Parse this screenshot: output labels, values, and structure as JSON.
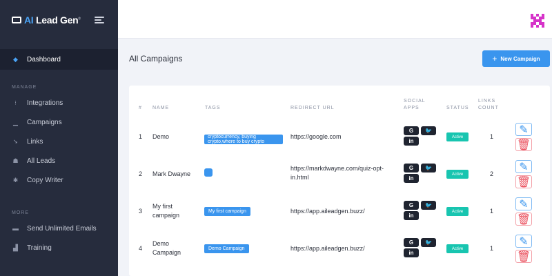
{
  "brand": {
    "ai": "AI",
    "rest": " Lead Gen",
    "tm": "®"
  },
  "sidebar": {
    "dashboard": "Dashboard",
    "manage_label": "MANAGE",
    "items": [
      {
        "label": "Integrations",
        "icon": "integrations-icon"
      },
      {
        "label": "Campaigns",
        "icon": "campaigns-icon"
      },
      {
        "label": "Links",
        "icon": "links-icon"
      },
      {
        "label": "All Leads",
        "icon": "users-icon"
      },
      {
        "label": "Copy Writer",
        "icon": "copywriter-icon"
      }
    ],
    "more_label": "MORE",
    "more_items": [
      {
        "label": "Send Unlimited Emails",
        "icon": "email-icon"
      },
      {
        "label": "Training",
        "icon": "training-icon"
      }
    ]
  },
  "main": {
    "title": "All Campaigns",
    "new_button": "New Campaign"
  },
  "table": {
    "headers": {
      "num": "#",
      "name": "NAME",
      "tags": "TAGS",
      "redirect": "REDIRECT URL",
      "social_1": "SOCIAL",
      "social_2": "APPS",
      "status": "STATUS",
      "links_1": "LINKS",
      "links_2": "COUNT"
    },
    "rows": [
      {
        "num": "1",
        "name": "Demo",
        "tag": "cryptocurrency, buying crypto,where to buy crypto",
        "url": "https://google.com",
        "status": "Active",
        "links": "1"
      },
      {
        "num": "2",
        "name": "Mark Dwayne",
        "tag": "",
        "url": "https://markdwayne.com/quiz-opt-in.html",
        "status": "Active",
        "links": "2"
      },
      {
        "num": "3",
        "name": "My first campaign",
        "tag": "My first campaign",
        "url": "https://app.aileadgen.buzz/",
        "status": "Active",
        "links": "1"
      },
      {
        "num": "4",
        "name": "Demo Campaign",
        "tag": "Demo Campaign",
        "url": "https://app.aileadgen.buzz/",
        "status": "Active",
        "links": "1"
      }
    ],
    "social_glyphs": {
      "google": "G",
      "twitter": "🐦",
      "linkedin": "in"
    },
    "action_glyphs": {
      "edit": "✎",
      "delete": "🗑"
    }
  },
  "colors": {
    "sidebar_bg": "#262c3d",
    "accent_blue": "#3a95ee",
    "status_green": "#18c5b0",
    "delete_red": "#ea4c5a",
    "avatar_magenta": "#d633c9"
  }
}
